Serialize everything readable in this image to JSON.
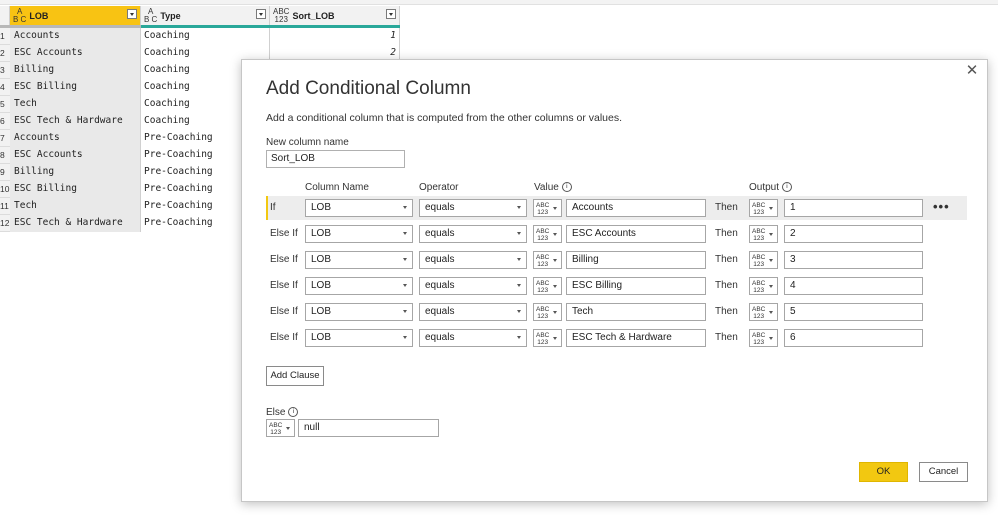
{
  "table": {
    "columns": [
      {
        "name": "LOB",
        "type_glyph_top": "A",
        "type_glyph_bottom": "B C",
        "selected": true
      },
      {
        "name": "Type",
        "type_glyph_top": "A",
        "type_glyph_bottom": "B C",
        "selected": false
      },
      {
        "name": "Sort_LOB",
        "type_glyph_top": "ABC",
        "type_glyph_bottom": "123",
        "selected": false
      }
    ],
    "rows": [
      {
        "num": "1",
        "lob": "Accounts",
        "type": "Coaching",
        "sort": "1"
      },
      {
        "num": "2",
        "lob": "ESC Accounts",
        "type": "Coaching",
        "sort": "2"
      },
      {
        "num": "3",
        "lob": "Billing",
        "type": "Coaching",
        "sort": ""
      },
      {
        "num": "4",
        "lob": "ESC Billing",
        "type": "Coaching",
        "sort": ""
      },
      {
        "num": "5",
        "lob": "Tech",
        "type": "Coaching",
        "sort": ""
      },
      {
        "num": "6",
        "lob": "ESC Tech & Hardware",
        "type": "Coaching",
        "sort": ""
      },
      {
        "num": "7",
        "lob": "Accounts",
        "type": "Pre-Coaching",
        "sort": ""
      },
      {
        "num": "8",
        "lob": "ESC Accounts",
        "type": "Pre-Coaching",
        "sort": ""
      },
      {
        "num": "9",
        "lob": "Billing",
        "type": "Pre-Coaching",
        "sort": ""
      },
      {
        "num": "10",
        "lob": "ESC Billing",
        "type": "Pre-Coaching",
        "sort": ""
      },
      {
        "num": "11",
        "lob": "Tech",
        "type": "Pre-Coaching",
        "sort": ""
      },
      {
        "num": "12",
        "lob": "ESC Tech & Hardware",
        "type": "Pre-Coaching",
        "sort": ""
      }
    ]
  },
  "dialog": {
    "title": "Add Conditional Column",
    "close_glyph": "✕",
    "subtitle": "Add a conditional column that is computed from the other columns or values.",
    "new_column_label": "New column name",
    "new_column_value": "Sort_LOB",
    "headers": {
      "column_name": "Column Name",
      "operator": "Operator",
      "value": "Value",
      "output": "Output",
      "info_glyph": "i"
    },
    "type_glyph_top": "ABC",
    "type_glyph_bottom": "123",
    "then_label": "Then",
    "more_glyph": "•••",
    "clauses": [
      {
        "keyword": "If",
        "column": "LOB",
        "operator": "equals",
        "value": "Accounts",
        "output": "1"
      },
      {
        "keyword": "Else If",
        "column": "LOB",
        "operator": "equals",
        "value": "ESC Accounts",
        "output": "2"
      },
      {
        "keyword": "Else If",
        "column": "LOB",
        "operator": "equals",
        "value": "Billing",
        "output": "3"
      },
      {
        "keyword": "Else If",
        "column": "LOB",
        "operator": "equals",
        "value": "ESC Billing",
        "output": "4"
      },
      {
        "keyword": "Else If",
        "column": "LOB",
        "operator": "equals",
        "value": "Tech",
        "output": "5"
      },
      {
        "keyword": "Else If",
        "column": "LOB",
        "operator": "equals",
        "value": "ESC Tech & Hardware",
        "output": "6"
      }
    ],
    "add_clause_label": "Add Clause",
    "else_label": "Else",
    "else_value": "null",
    "ok_label": "OK",
    "cancel_label": "Cancel"
  },
  "colors": {
    "accent_yellow": "#f2c811",
    "selected_header": "#f8c313",
    "quality_bar": "#2aa89a"
  }
}
